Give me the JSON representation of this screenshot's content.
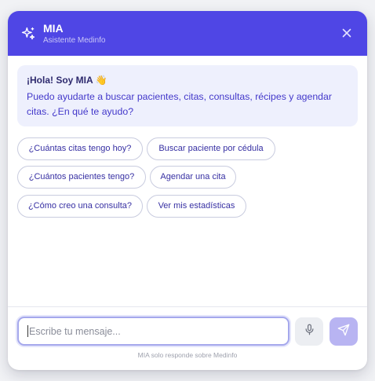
{
  "colors": {
    "brand": "#4f46e5",
    "greeting_bg": "#eef0fd",
    "chip_text": "#3730a3",
    "send_bg": "#b8b4f2"
  },
  "header": {
    "icon": "sparkles-icon",
    "title": "MIA",
    "subtitle": "Asistente Medinfo",
    "close_icon": "close-icon"
  },
  "greeting": {
    "hello": "¡Hola! Soy MIA",
    "wave": "👋",
    "message": "Puedo ayudarte a buscar pacientes, citas, consultas, récipes y agendar citas. ¿En qué te ayudo?"
  },
  "suggestions": [
    "¿Cuántas citas tengo hoy?",
    "Buscar paciente por cédula",
    "¿Cuántos pacientes tengo?",
    "Agendar una cita",
    "¿Cómo creo una consulta?",
    "Ver mis estadísticas"
  ],
  "composer": {
    "placeholder": "Escribe tu mensaje...",
    "mic_icon": "microphone-icon",
    "send_icon": "send-icon"
  },
  "footer": {
    "note": "MIA solo responde sobre Medinfo"
  }
}
